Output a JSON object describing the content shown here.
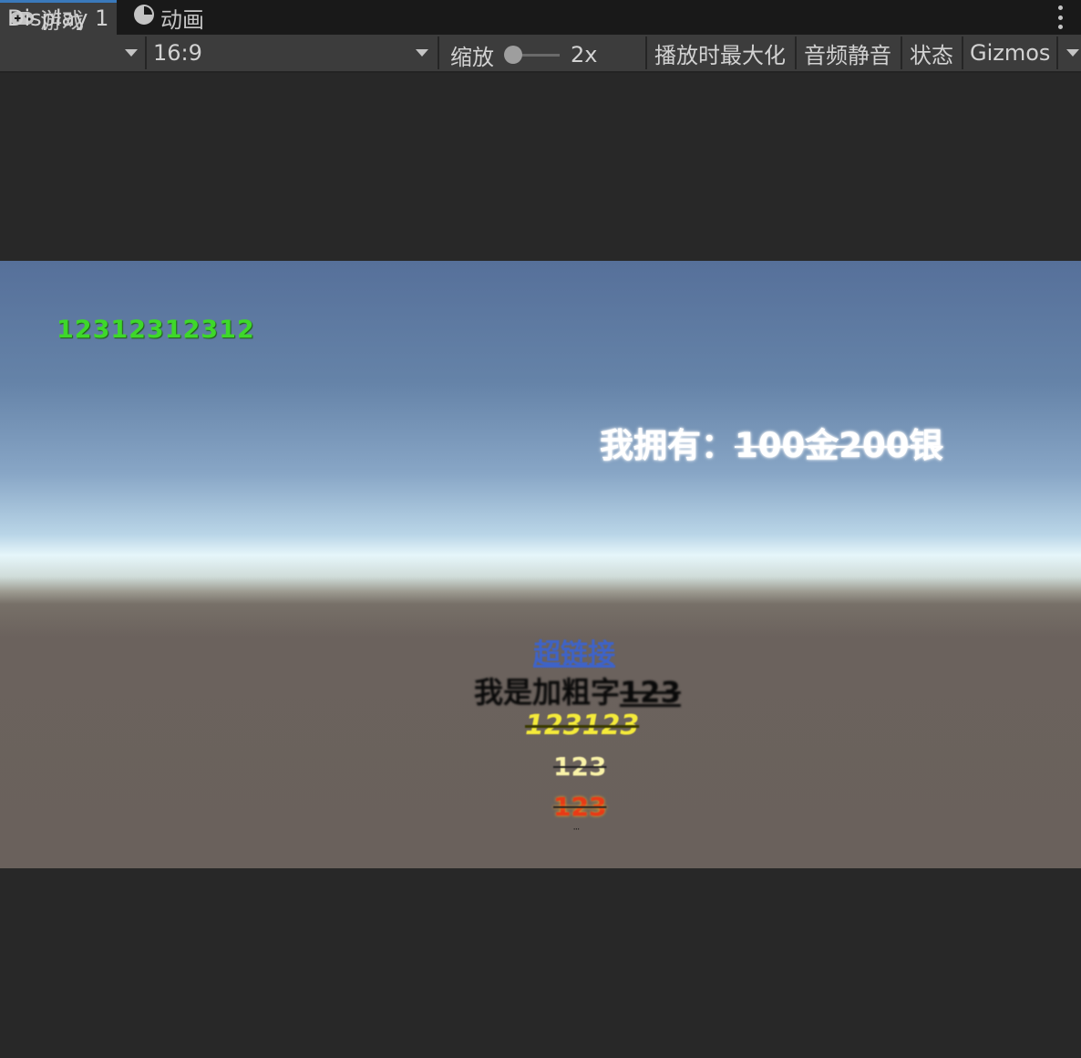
{
  "tabs": [
    {
      "label": "游戏",
      "icon": "gamepad-icon",
      "active": true
    },
    {
      "label": "动画",
      "icon": "animation-clock-icon",
      "active": false
    }
  ],
  "toolbar": {
    "display": "Display 1",
    "aspect": "16:9",
    "scale_label": "缩放",
    "scale_value": "2x",
    "scale_slider_level": 0.0,
    "maximize_on_play": "播放时最大化",
    "mute_audio": "音频静音",
    "stats": "状态",
    "gizmos": "Gizmos"
  },
  "game": {
    "number_text": "12312312312",
    "wealth_prefix": "我拥有：",
    "wealth_amount": "100金200银",
    "link_text": "超链接",
    "line1_plain": "我是",
    "line1_bold": "加粗字",
    "line1_under": "123",
    "italic_yellow": "123123",
    "yellow": "123",
    "red": "123",
    "tiny": "···"
  },
  "colors": {
    "tab_accent": "#3a79bb",
    "green_text": "#3ed82a",
    "link_text": "#3e63c8",
    "yellow_text": "#f4ea3a",
    "red_text": "#e83a16"
  }
}
